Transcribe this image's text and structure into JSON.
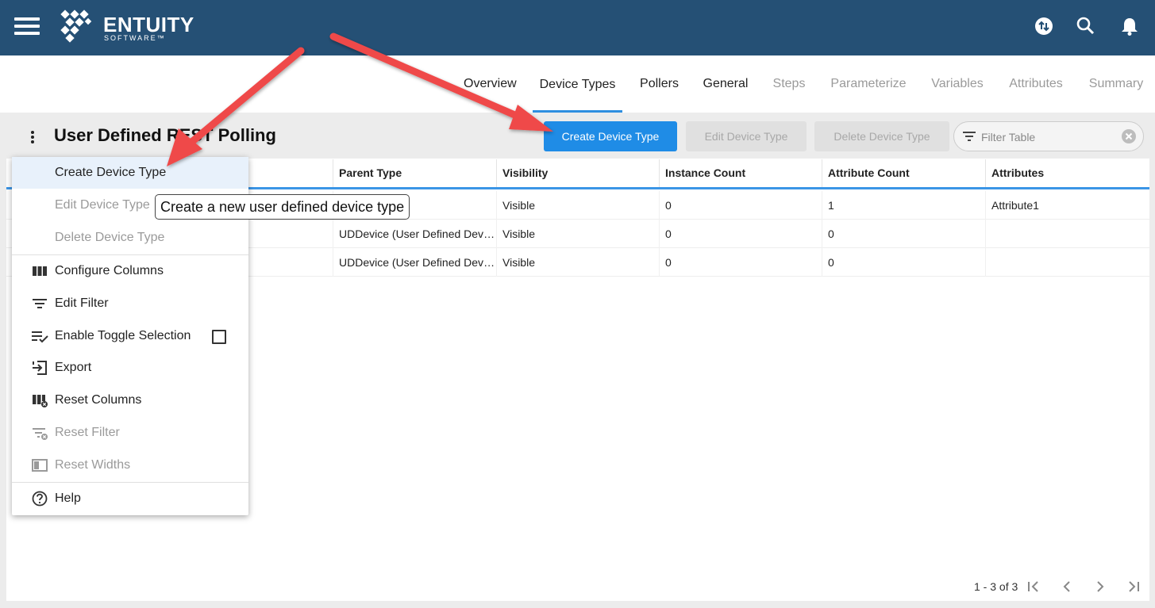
{
  "header": {
    "brand_name": "ENTUITY",
    "brand_sub": "SOFTWARE™",
    "icons": [
      "menu-icon",
      "sync-icon",
      "search-icon",
      "bell-icon"
    ]
  },
  "wizard": {
    "tabs": [
      {
        "label": "Overview",
        "state": "enabled"
      },
      {
        "label": "Device Types",
        "state": "active"
      },
      {
        "label": "Pollers",
        "state": "enabled"
      },
      {
        "label": "General",
        "state": "enabled"
      },
      {
        "label": "Steps",
        "state": "disabled"
      },
      {
        "label": "Parameterize",
        "state": "disabled"
      },
      {
        "label": "Variables",
        "state": "disabled"
      },
      {
        "label": "Attributes",
        "state": "disabled"
      },
      {
        "label": "Summary",
        "state": "disabled"
      }
    ]
  },
  "page": {
    "title": "User Defined REST Polling"
  },
  "toolbar": {
    "create_label": "Create Device Type",
    "edit_label": "Edit Device Type",
    "delete_label": "Delete Device Type",
    "filter_placeholder": "Filter Table"
  },
  "table": {
    "columns": [
      "",
      "Parent Type",
      "Visibility",
      "Instance Count",
      "Attribute Count",
      "Attributes"
    ],
    "rows": [
      [
        "",
        "",
        "Visible",
        "0",
        "1",
        "Attribute1"
      ],
      [
        "",
        "UDDevice (User Defined Devi…",
        "Visible",
        "0",
        "0",
        ""
      ],
      [
        "",
        "UDDevice (User Defined Devi…",
        "Visible",
        "0",
        "0",
        ""
      ]
    ]
  },
  "pagination": {
    "range_text": "1 - 3 of 3"
  },
  "menu": {
    "items": [
      {
        "label": "Create Device Type",
        "state": "enabled",
        "icon": ""
      },
      {
        "label": "Edit Device Type",
        "state": "disabled",
        "icon": ""
      },
      {
        "label": "Delete Device Type",
        "state": "disabled",
        "icon": ""
      },
      {
        "label": "Configure Columns",
        "state": "enabled",
        "icon": "columns-icon"
      },
      {
        "label": "Edit Filter",
        "state": "enabled",
        "icon": "filter-icon"
      },
      {
        "label": "Enable Toggle Selection",
        "state": "enabled",
        "icon": "list-check-icon"
      },
      {
        "label": "Export",
        "state": "enabled",
        "icon": "export-icon"
      },
      {
        "label": "Reset Columns",
        "state": "enabled",
        "icon": "reset-columns-icon"
      },
      {
        "label": "Reset Filter",
        "state": "disabled",
        "icon": "reset-filter-icon"
      },
      {
        "label": "Reset Widths",
        "state": "disabled",
        "icon": "reset-widths-icon"
      },
      {
        "label": "Help",
        "state": "enabled",
        "icon": "help-icon"
      }
    ],
    "toggle_selection_checked": false
  },
  "tooltip": {
    "text": "Create a new user defined device type"
  },
  "colors": {
    "header_bg": "#255075",
    "accent": "#1f8ce6",
    "annotation_arrow": "#ef4848"
  }
}
